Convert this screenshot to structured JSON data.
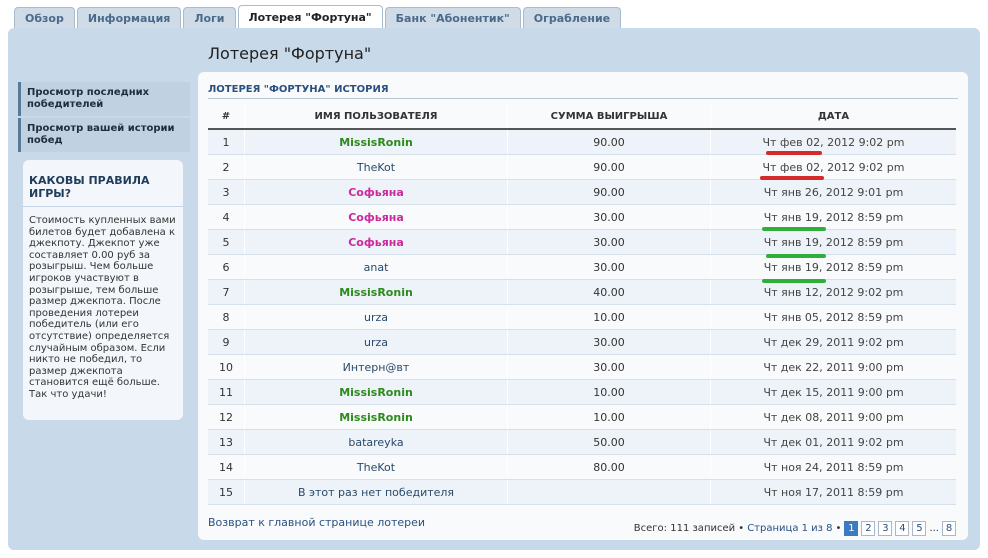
{
  "tabs": [
    "Обзор",
    "Информация",
    "Логи",
    "Лотерея \"Фортуна\"",
    "Банк \"Абонентик\"",
    "Ограбление"
  ],
  "page_title": "Лотерея \"Фортуна\"",
  "nav": {
    "item1": "Просмотр последних победителей",
    "item2": "Просмотр вашей истории побед"
  },
  "rules": {
    "title": "КАКОВЫ ПРАВИЛА ИГРЫ?",
    "text": "Стоимость купленных вами билетов будет добавлена к джекпоту. Джекпот уже составляет 0.00 руб за розыгрыш. Чем больше игроков участвуют в розыгрыше, тем больше размер джекпота. После проведения лотереи победитель (или его отсутствие) определяется случайным образом. Если никто не победил, то размер джекпота становится ещё больше. Так что удачи!"
  },
  "history": {
    "title": "ЛОТЕРЕЯ \"ФОРТУНА\" ИСТОРИЯ",
    "columns": [
      "#",
      "ИМЯ ПОЛЬЗОВАТЕЛЯ",
      "СУММА ВЫИГРЫША",
      "ДАТА"
    ],
    "rows": [
      {
        "n": "1",
        "user": "MissisRonin",
        "style": "green",
        "sum": "90.00",
        "date": "Чт фев 02, 2012 9:02 pm"
      },
      {
        "n": "2",
        "user": "TheKot",
        "style": "blue",
        "sum": "90.00",
        "date": "Чт фев 02, 2012 9:02 pm"
      },
      {
        "n": "3",
        "user": "Софьяна",
        "style": "pink",
        "sum": "90.00",
        "date": "Чт янв 26, 2012 9:01 pm"
      },
      {
        "n": "4",
        "user": "Софьяна",
        "style": "pink",
        "sum": "30.00",
        "date": "Чт янв 19, 2012 8:59 pm"
      },
      {
        "n": "5",
        "user": "Софьяна",
        "style": "pink",
        "sum": "30.00",
        "date": "Чт янв 19, 2012 8:59 pm"
      },
      {
        "n": "6",
        "user": "anat",
        "style": "blue",
        "sum": "30.00",
        "date": "Чт янв 19, 2012 8:59 pm"
      },
      {
        "n": "7",
        "user": "MissisRonin",
        "style": "green",
        "sum": "40.00",
        "date": "Чт янв 12, 2012 9:02 pm"
      },
      {
        "n": "8",
        "user": "urza",
        "style": "blue",
        "sum": "10.00",
        "date": "Чт янв 05, 2012 8:59 pm"
      },
      {
        "n": "9",
        "user": "urza",
        "style": "blue",
        "sum": "30.00",
        "date": "Чт дек 29, 2011 9:02 pm"
      },
      {
        "n": "10",
        "user": "Интерн@вт",
        "style": "blue",
        "sum": "30.00",
        "date": "Чт дек 22, 2011 9:00 pm"
      },
      {
        "n": "11",
        "user": "MissisRonin",
        "style": "green",
        "sum": "10.00",
        "date": "Чт дек 15, 2011 9:00 pm"
      },
      {
        "n": "12",
        "user": "MissisRonin",
        "style": "green",
        "sum": "10.00",
        "date": "Чт дек 08, 2011 9:00 pm"
      },
      {
        "n": "13",
        "user": "batareyka",
        "style": "blue",
        "sum": "50.00",
        "date": "Чт дек 01, 2011 9:02 pm"
      },
      {
        "n": "14",
        "user": "TheKot",
        "style": "blue",
        "sum": "80.00",
        "date": "Чт ноя 24, 2011 8:59 pm"
      },
      {
        "n": "15",
        "user": "В этот раз нет победителя",
        "style": "plain",
        "sum": "",
        "date": "Чт ноя 17, 2011 8:59 pm"
      }
    ]
  },
  "back_link": "Возврат к главной странице лотереи",
  "pager": {
    "total": "Всего: 111 записей •",
    "page_label": "Страница 1 из 8",
    "bullet": "•",
    "pages": [
      "1",
      "2",
      "3",
      "4",
      "5"
    ],
    "ellipsis": "...",
    "last": "8",
    "current": "1"
  },
  "colors": {
    "red_mark": "#d42a2a",
    "green_mark": "#2fae3c"
  }
}
